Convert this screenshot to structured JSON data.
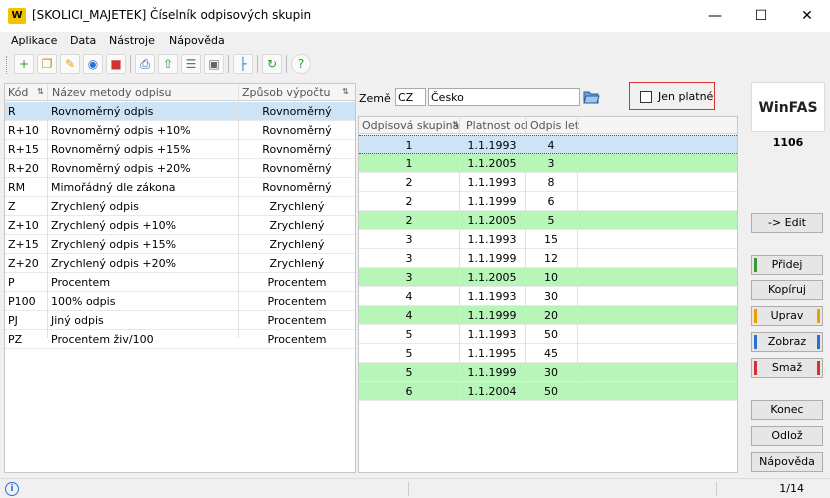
{
  "window": {
    "title": "[SKOLICI_MAJETEK] Číselník odpisových skupin",
    "logo_text": "W"
  },
  "menu": [
    "Aplikace",
    "Data",
    "Nástroje",
    "Nápověda"
  ],
  "toolbar_icons": [
    "add-icon",
    "copy-icon",
    "edit-icon",
    "view-icon",
    "delete-icon",
    "print-icon",
    "export-icon",
    "grid-icon",
    "layout-icon",
    "tree-icon",
    "refresh-icon",
    "help-icon"
  ],
  "left_table": {
    "headers": [
      "Kód",
      "Název metody odpisu",
      "Způsob výpočtu"
    ],
    "rows": [
      [
        "R",
        "Rovnoměrný odpis",
        "Rovnoměrný"
      ],
      [
        "R+10",
        "Rovnoměrný odpis +10%",
        "Rovnoměrný"
      ],
      [
        "R+15",
        "Rovnoměrný odpis +15%",
        "Rovnoměrný"
      ],
      [
        "R+20",
        "Rovnoměrný odpis +20%",
        "Rovnoměrný"
      ],
      [
        "RM",
        "Mimořádný dle zákona",
        "Rovnoměrný"
      ],
      [
        "Z",
        "Zrychlený odpis",
        "Zrychlený"
      ],
      [
        "Z+10",
        "Zrychlený odpis +10%",
        "Zrychlený"
      ],
      [
        "Z+15",
        "Zrychlený odpis +15%",
        "Zrychlený"
      ],
      [
        "Z+20",
        "Zrychlený odpis +20%",
        "Zrychlený"
      ],
      [
        "P",
        "Procentem",
        "Procentem"
      ],
      [
        "P100",
        "100% odpis",
        "Procentem"
      ],
      [
        "PJ",
        "Jiný odpis",
        "Procentem"
      ],
      [
        "PZ",
        "Procentem živ/100",
        "Procentem"
      ]
    ]
  },
  "filter": {
    "zeme_label": "Země :",
    "zeme_code": "CZ",
    "zeme_name": "Česko",
    "jen_platne_label": "Jen platné"
  },
  "right_table": {
    "headers": [
      "Odpisová skupina",
      "Platnost od",
      "Odpis let"
    ],
    "rows": [
      {
        "cells": [
          "1",
          "1.1.1993",
          "4"
        ],
        "style": "sel"
      },
      {
        "cells": [
          "1",
          "1.1.2005",
          "3"
        ],
        "style": "green"
      },
      {
        "cells": [
          "2",
          "1.1.1993",
          "8"
        ],
        "style": ""
      },
      {
        "cells": [
          "2",
          "1.1.1999",
          "6"
        ],
        "style": ""
      },
      {
        "cells": [
          "2",
          "1.1.2005",
          "5"
        ],
        "style": "green"
      },
      {
        "cells": [
          "3",
          "1.1.1993",
          "15"
        ],
        "style": ""
      },
      {
        "cells": [
          "3",
          "1.1.1999",
          "12"
        ],
        "style": ""
      },
      {
        "cells": [
          "3",
          "1.1.2005",
          "10"
        ],
        "style": "green"
      },
      {
        "cells": [
          "4",
          "1.1.1993",
          "30"
        ],
        "style": ""
      },
      {
        "cells": [
          "4",
          "1.1.1999",
          "20"
        ],
        "style": "green"
      },
      {
        "cells": [
          "5",
          "1.1.1993",
          "50"
        ],
        "style": ""
      },
      {
        "cells": [
          "5",
          "1.1.1995",
          "45"
        ],
        "style": ""
      },
      {
        "cells": [
          "5",
          "1.1.1999",
          "30"
        ],
        "style": "green"
      },
      {
        "cells": [
          "6",
          "1.1.2004",
          "50"
        ],
        "style": "green"
      }
    ]
  },
  "side": {
    "logo": "WinFAS",
    "code": "1106",
    "edit": "-> Edit",
    "pridej": "Přidej",
    "kopiruj": "Kopíruj",
    "uprav": "Uprav",
    "zobraz": "Zobraz",
    "smaz": "Smaž",
    "konec": "Konec",
    "odloz": "Odlož",
    "napoveda": "Nápověda"
  },
  "status": {
    "page": "1/14"
  },
  "colors": {
    "selected_row": "#cde4f7",
    "valid_row": "#b8f5b8",
    "accent_green": "#3a9a3a",
    "accent_orange": "#e8a000",
    "accent_blue": "#2a6fd1",
    "accent_red": "#d33333"
  }
}
